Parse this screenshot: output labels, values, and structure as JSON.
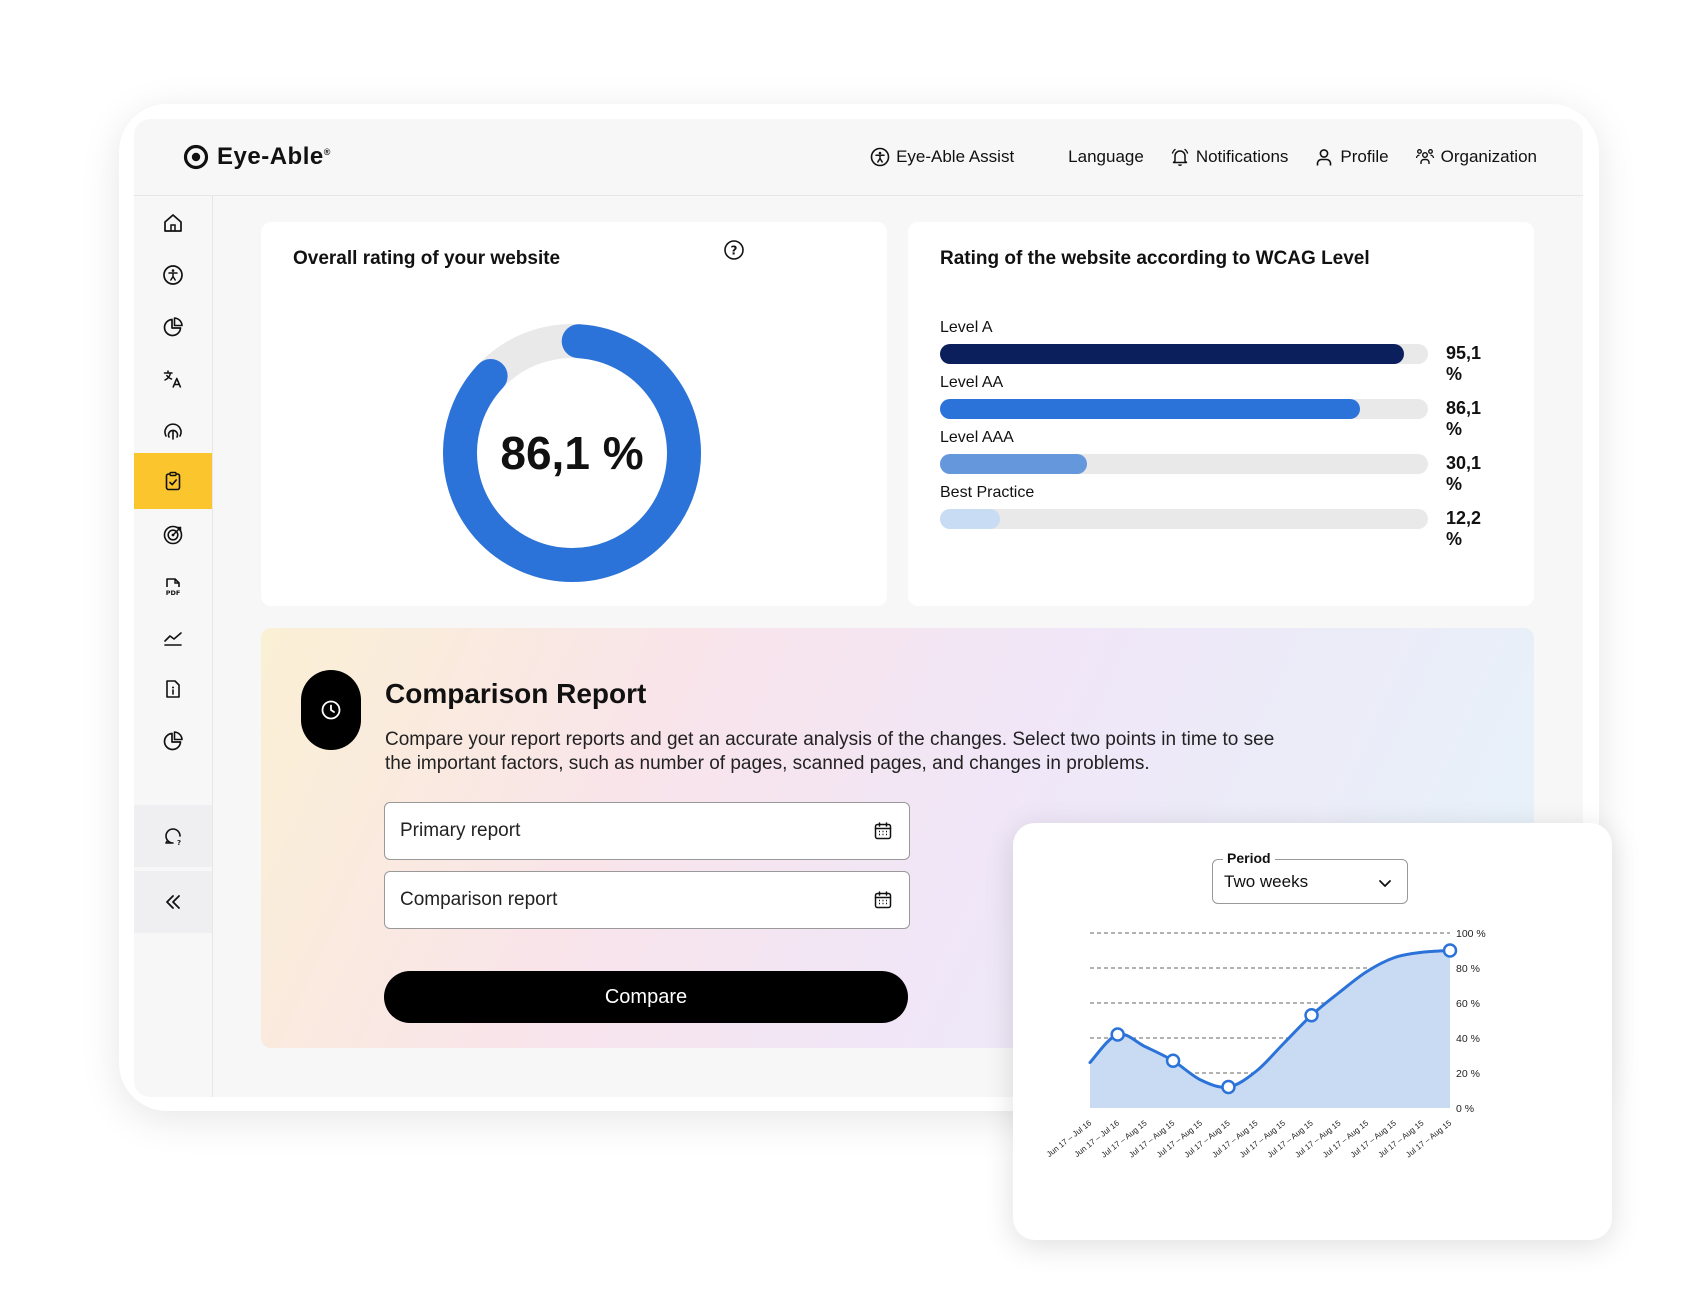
{
  "brand": {
    "name": "Eye-Able",
    "reg": "®"
  },
  "nav": {
    "assist": "Eye-Able Assist",
    "language": "Language",
    "notifications": "Notifications",
    "profile": "Profile",
    "organization": "Organization"
  },
  "sidebar": {
    "items": [
      {
        "icon": "home-icon"
      },
      {
        "icon": "accessibility-icon"
      },
      {
        "icon": "pie-chart-icon"
      },
      {
        "icon": "translate-icon"
      },
      {
        "icon": "fingerprint-icon"
      },
      {
        "icon": "clipboard-check-icon",
        "active": true
      },
      {
        "icon": "target-icon"
      },
      {
        "icon": "pdf-icon"
      },
      {
        "icon": "line-chart-icon"
      },
      {
        "icon": "document-info-icon"
      },
      {
        "icon": "pie-chart-icon"
      }
    ],
    "help_icon": "chat-question-icon",
    "collapse_icon": "double-chevron-left-icon"
  },
  "overall": {
    "title": "Overall rating of your website",
    "value_label": "86,1 %",
    "value": 86.1
  },
  "wcag": {
    "title": "Rating of the website according to WCAG Level",
    "levels": [
      {
        "name": "Level A",
        "value": 95.1,
        "label": "95,1 %",
        "color": "#0b1f5c"
      },
      {
        "name": "Level AA",
        "value": 86.1,
        "label": "86,1 %",
        "color": "#2b73d9"
      },
      {
        "name": "Level AAA",
        "value": 30.1,
        "label": "30,1 %",
        "color": "#6597dc"
      },
      {
        "name": "Best Practice",
        "value": 12.2,
        "label": "12,2 %",
        "color": "#c8dcf3"
      }
    ]
  },
  "comparison": {
    "title": "Comparison Report",
    "description": "Compare your report reports and get an accurate analysis of the changes. Select two points in time to see the important factors, such as number of pages, scanned pages, and changes in problems.",
    "primary_placeholder": "Primary report",
    "comparison_placeholder": "Comparison report",
    "button": "Compare"
  },
  "period": {
    "label": "Period",
    "value": "Two weeks"
  },
  "chart_data": {
    "type": "area",
    "ylim": [
      0,
      100
    ],
    "y_ticks": [
      "100 %",
      "80 %",
      "60 %",
      "40 %",
      "20 %",
      "0 %"
    ],
    "x": [
      "Jun 17 – Jul 16",
      "Jun 17 – Jul 16",
      "Jul 17 – Aug 15",
      "Jul 17 – Aug 15",
      "Jul 17 – Aug 15",
      "Jul 17 – Aug 15",
      "Jul 17 – Aug 15",
      "Jul 17 – Aug 15",
      "Jul 17 – Aug 15",
      "Jul 17 – Aug 15",
      "Jul 17 – Aug 15",
      "Jul 17 – Aug 15",
      "Jul 17 – Aug 15",
      "Jul 17 – Aug 15"
    ],
    "series": [
      {
        "values": [
          26,
          42,
          35,
          27,
          16,
          12,
          21,
          37,
          53,
          66,
          78,
          86,
          89,
          90
        ]
      }
    ],
    "markers": [
      1,
      3,
      5,
      8,
      13
    ],
    "colors": {
      "line": "#2b73d9",
      "fill": "#c9dbf3"
    },
    "grid": true
  }
}
